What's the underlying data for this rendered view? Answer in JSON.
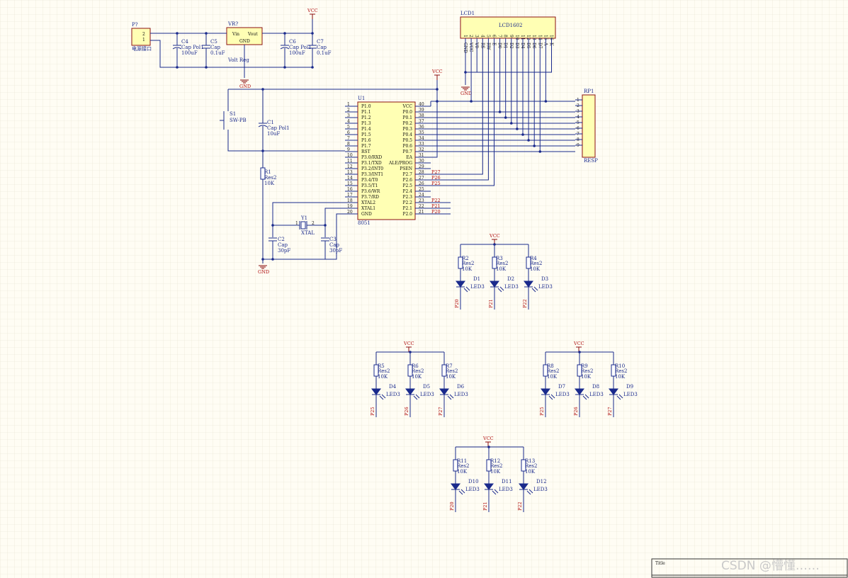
{
  "schematic": {
    "power_connector": {
      "ref": "P?",
      "pins": [
        "2",
        "1"
      ],
      "caption": "电源接口"
    },
    "regulator": {
      "ref": "VR?",
      "vin": "Vin",
      "vout": "Vout",
      "gnd": "GND",
      "name": "Volt Reg"
    },
    "caps_power": [
      {
        "ref": "C4",
        "type": "Cap Pol1",
        "value": "100uF"
      },
      {
        "ref": "C5",
        "type": "Cap",
        "value": "0.1uF"
      },
      {
        "ref": "C6",
        "type": "Cap Pol1",
        "value": "100uF"
      },
      {
        "ref": "C7",
        "type": "Cap",
        "value": "0.1uF"
      }
    ],
    "net_vcc": "VCC",
    "net_gnd": "GND",
    "lcd": {
      "ref": "LCD1",
      "name": "LCD1602",
      "pin_numbers": [
        "1",
        "2",
        "3",
        "4",
        "5",
        "6",
        "7",
        "8",
        "9",
        "10",
        "11",
        "12",
        "13",
        "14",
        "15",
        "16"
      ],
      "pin_names": [
        "GND",
        "VCC",
        "V0",
        "RS",
        "RW",
        "E",
        "D0",
        "D1",
        "D2",
        "D3",
        "D4",
        "D5",
        "D6",
        "D7",
        "A",
        "K"
      ]
    },
    "resistor_pack": {
      "ref": "RP1",
      "name": "RESP",
      "pins": [
        "1",
        "2",
        "3",
        "4",
        "5",
        "6",
        "7",
        "8",
        "9"
      ]
    },
    "mcu": {
      "ref": "U1",
      "name": "8051",
      "left_pins": [
        {
          "n": "1",
          "name": "P1.0"
        },
        {
          "n": "2",
          "name": "P1.1"
        },
        {
          "n": "3",
          "name": "P1.2"
        },
        {
          "n": "4",
          "name": "P1.3"
        },
        {
          "n": "5",
          "name": "P1.4"
        },
        {
          "n": "6",
          "name": "P1.5"
        },
        {
          "n": "7",
          "name": "P1.6"
        },
        {
          "n": "8",
          "name": "P1.7"
        },
        {
          "n": "9",
          "name": "RST"
        },
        {
          "n": "10",
          "name": "P3.0/RXD"
        },
        {
          "n": "11",
          "name": "P3.1/TXD"
        },
        {
          "n": "12",
          "name": "P3.2/INT0"
        },
        {
          "n": "13",
          "name": "P3.3/INT1"
        },
        {
          "n": "14",
          "name": "P3.4/T0"
        },
        {
          "n": "15",
          "name": "P3.5/T1"
        },
        {
          "n": "16",
          "name": "P3.6/WR"
        },
        {
          "n": "17",
          "name": "P3.7/RD"
        },
        {
          "n": "18",
          "name": "XTAL2"
        },
        {
          "n": "19",
          "name": "XTAL1"
        },
        {
          "n": "20",
          "name": "GND"
        }
      ],
      "right_pins": [
        {
          "n": "40",
          "name": "VCC",
          "net": ""
        },
        {
          "n": "39",
          "name": "P0.0",
          "net": ""
        },
        {
          "n": "38",
          "name": "P0.1",
          "net": ""
        },
        {
          "n": "37",
          "name": "P0.2",
          "net": ""
        },
        {
          "n": "36",
          "name": "P0.3",
          "net": ""
        },
        {
          "n": "35",
          "name": "P0.4",
          "net": ""
        },
        {
          "n": "34",
          "name": "P0.5",
          "net": ""
        },
        {
          "n": "33",
          "name": "P0.6",
          "net": ""
        },
        {
          "n": "32",
          "name": "P0.7",
          "net": ""
        },
        {
          "n": "31",
          "name": "EA",
          "net": ""
        },
        {
          "n": "30",
          "name": "ALE/PROG",
          "net": ""
        },
        {
          "n": "29",
          "name": "PSEN",
          "net": ""
        },
        {
          "n": "28",
          "name": "P2.7",
          "net": "P27"
        },
        {
          "n": "27",
          "name": "P2.6",
          "net": "P26"
        },
        {
          "n": "26",
          "name": "P2.5",
          "net": "P25"
        },
        {
          "n": "25",
          "name": "P2.4",
          "net": ""
        },
        {
          "n": "24",
          "name": "P2.3",
          "net": ""
        },
        {
          "n": "23",
          "name": "P2.2",
          "net": "P22"
        },
        {
          "n": "22",
          "name": "P2.1",
          "net": "P21"
        },
        {
          "n": "21",
          "name": "P2.0",
          "net": "P20"
        }
      ]
    },
    "switch": {
      "ref": "S1",
      "type": "SW-PB"
    },
    "c1": {
      "ref": "C1",
      "type": "Cap Pol1",
      "value": "10uF"
    },
    "r1": {
      "ref": "R1",
      "type": "Res2",
      "value": "10K"
    },
    "crystal": {
      "ref": "Y1",
      "type": "XTAL",
      "pin1": "1",
      "pin2": "2"
    },
    "c2": {
      "ref": "C2",
      "type": "Cap",
      "value": "30pF"
    },
    "c3": {
      "ref": "C3",
      "type": "Cap",
      "value": "30pF"
    },
    "led_groups": [
      {
        "items": [
          {
            "r": "R2",
            "d": "D1",
            "net": "P20"
          },
          {
            "r": "R3",
            "d": "D2",
            "net": "P21"
          },
          {
            "r": "R4",
            "d": "D3",
            "net": "P22"
          }
        ]
      },
      {
        "items": [
          {
            "r": "R5",
            "d": "D4",
            "net": "P25"
          },
          {
            "r": "R6",
            "d": "D5",
            "net": "P26"
          },
          {
            "r": "R7",
            "d": "D6",
            "net": "P27"
          }
        ]
      },
      {
        "items": [
          {
            "r": "R8",
            "d": "D7",
            "net": "P25"
          },
          {
            "r": "R9",
            "d": "D8",
            "net": "P26"
          },
          {
            "r": "R10",
            "d": "D9",
            "net": "P27"
          }
        ]
      },
      {
        "items": [
          {
            "r": "R11",
            "d": "D10",
            "net": "P20"
          },
          {
            "r": "R12",
            "d": "D11",
            "net": "P21"
          },
          {
            "r": "R13",
            "d": "D12",
            "net": "P22"
          }
        ]
      }
    ],
    "res_type": "Res2",
    "res_value": "10K",
    "led_type": "LED3",
    "title_block_label": "Title",
    "watermark": "CSDN @懵懂……"
  }
}
